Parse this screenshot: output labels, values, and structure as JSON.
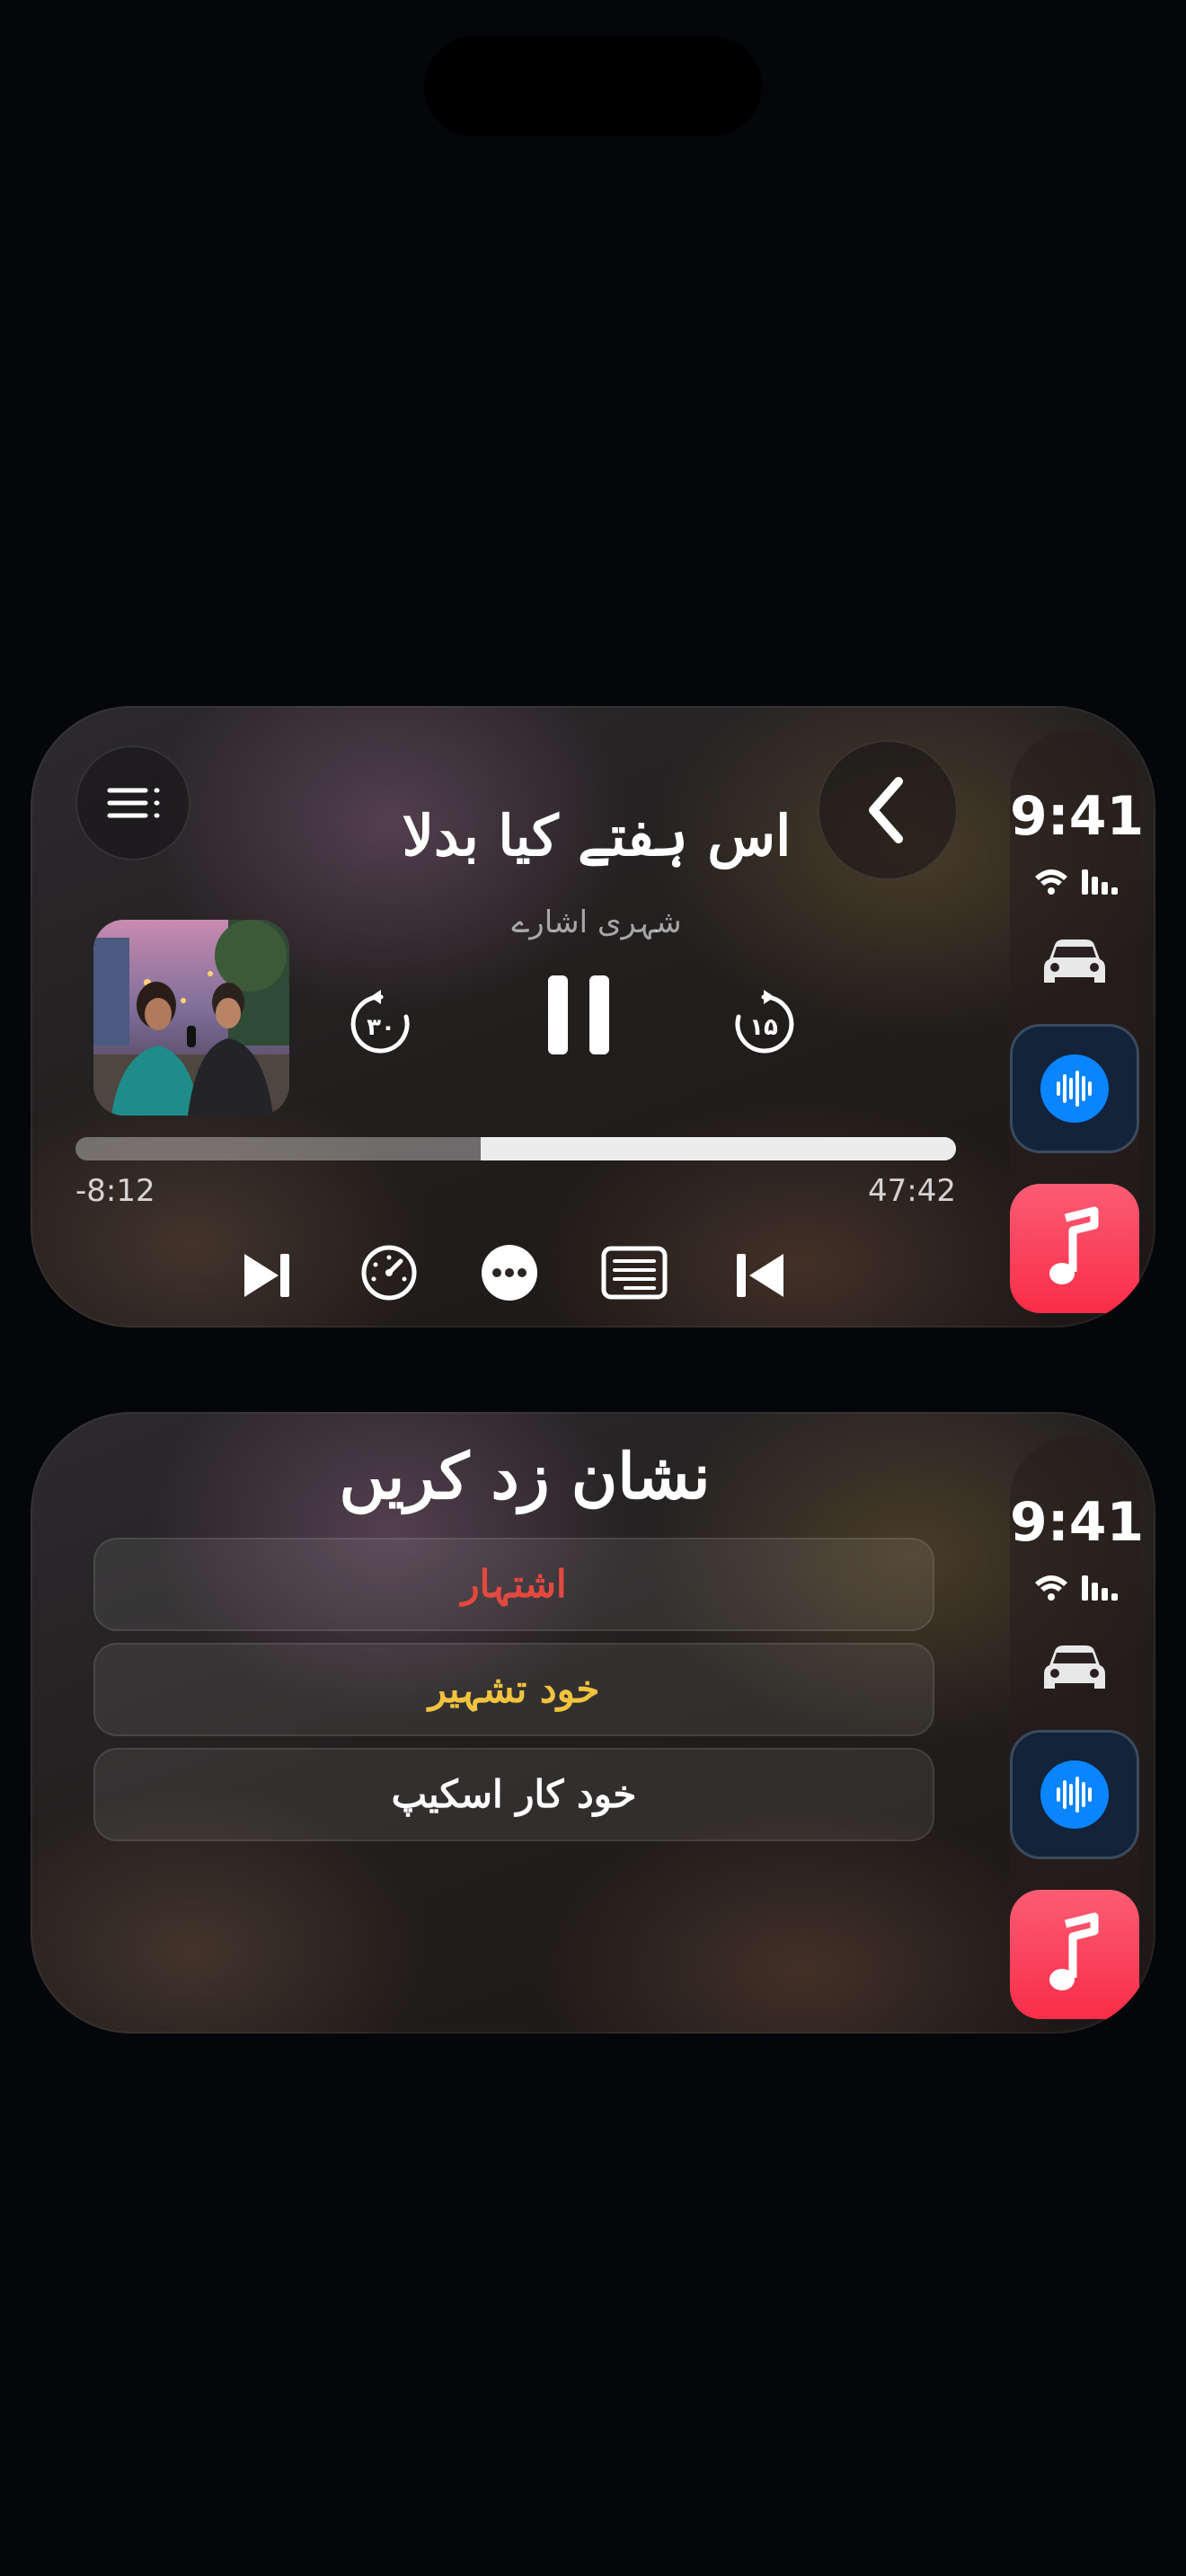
{
  "side_bar": {
    "time": "9:41",
    "wifi_icon": "wifi-icon",
    "signal_icon": "cellular-signal-icon",
    "car_icon": "car-icon",
    "apps": [
      "podcasts-app-icon",
      "music-app-icon"
    ],
    "podcast_color": "#0a84ff",
    "music_color": "#fa2d48"
  },
  "player": {
    "title": "اس ہفتے کیا بدلا",
    "subtitle": "شہری اشارے",
    "time_remaining": "-8:12",
    "total_time": "47:42",
    "progress_fraction": 0.54,
    "skip_back_label": "۳۰",
    "skip_forward_label": "۱۵",
    "buttons": {
      "menu": "list-menu-icon",
      "back": "chevron-left-icon",
      "play_pause": "pause-icon",
      "next": "next-track-icon",
      "speed": "playback-speed-icon",
      "more": "more-icon",
      "transcript": "transcript-icon",
      "previous": "previous-track-icon"
    }
  },
  "mark_panel": {
    "title": "نشان زد کریں",
    "options": [
      {
        "label": "اشتہار",
        "color": "#e5483f"
      },
      {
        "label": "خود تشہیر",
        "color": "#f1c33f"
      },
      {
        "label": "خود کار اسکیپ",
        "color": "#ffffff"
      }
    ]
  }
}
